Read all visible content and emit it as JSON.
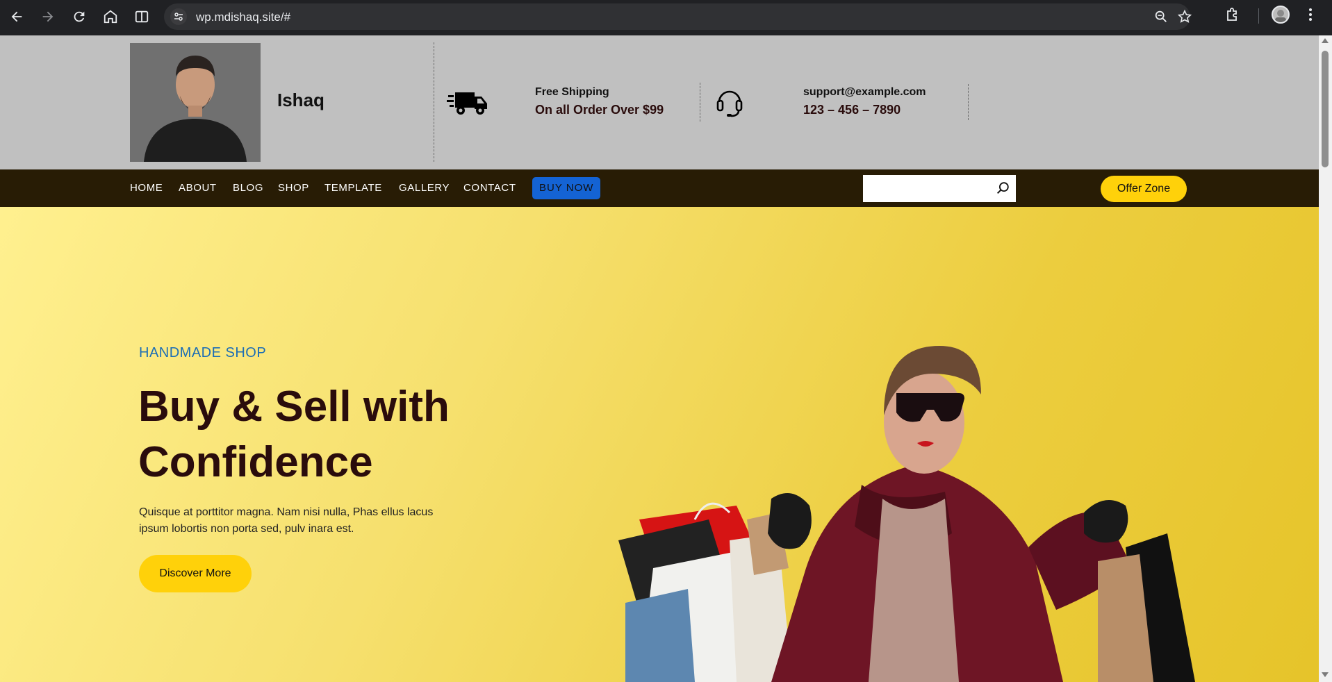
{
  "browser": {
    "url": "wp.mdishaq.site/#",
    "icons": [
      "back-icon",
      "forward-icon",
      "reload-icon",
      "home-icon",
      "reading-mode-icon",
      "site-info-icon",
      "zoom-icon",
      "star-icon",
      "extensions-icon",
      "profile-avatar",
      "more-menu-icon"
    ]
  },
  "header": {
    "brand": "Ishaq",
    "shipping": {
      "title": "Free Shipping",
      "subtitle": "On all Order Over $99"
    },
    "support": {
      "email": "support@example.com",
      "phone": "123 – 456 – 7890"
    }
  },
  "nav": {
    "items": [
      "HOME",
      "ABOUT",
      "BLOG",
      "SHOP",
      "TEMPLATE",
      "GALLERY",
      "CONTACT"
    ],
    "buy_now": "BUY NOW",
    "search_placeholder": "",
    "offer": "Offer Zone"
  },
  "hero": {
    "kicker": "HANDMADE SHOP",
    "headline": "Buy & Sell with Confidence",
    "paragraph": "Quisque at porttitor magna. Nam nisi nulla, Phas ellus lacus ipsum lobortis non porta sed, pulv inara est.",
    "cta": "Discover More"
  },
  "colors": {
    "nav_bg": "#281c05",
    "accent_yellow": "#ffd10a",
    "buy_now_blue": "#1463d4",
    "kicker_blue": "#1b6db5",
    "headline": "#2a0c0c"
  }
}
